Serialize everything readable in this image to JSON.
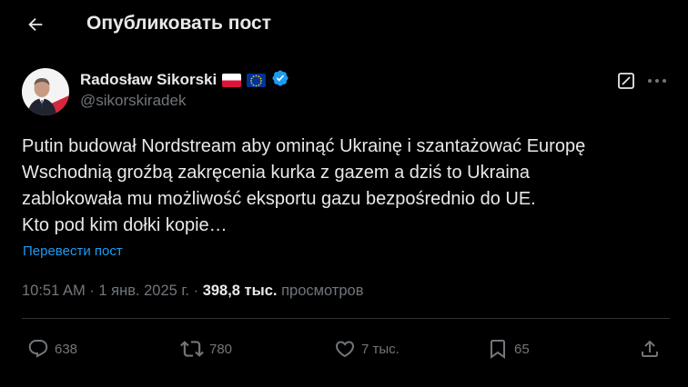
{
  "header": {
    "title": "Опубликовать пост"
  },
  "author": {
    "name": "Radosław Sikorski",
    "handle": "@sikorskiradek",
    "flags": [
      "poland-flag",
      "eu-flag"
    ],
    "verified": true
  },
  "post": {
    "lines": [
      "Putin budował Nordstream aby ominąć Ukrainę i szantażować Europę",
      "Wschodnią groźbą zakręcenia kurka z gazem a dziś to Ukraina",
      "zablokowała mu możliwość eksportu gazu bezpośrednio do UE.",
      "Kto pod kim dołki kopie…"
    ],
    "translate_label": "Перевести пост"
  },
  "meta": {
    "time": "10:51 AM",
    "separator": " · ",
    "date": "1 янв. 2025 г.",
    "views_count": "398,8 тыс.",
    "views_label": " просмотров"
  },
  "actions": {
    "replies": "638",
    "reposts": "780",
    "likes": "7 тыс.",
    "bookmarks": "65"
  },
  "colors": {
    "background": "#000000",
    "text": "#e7e9ea",
    "secondary": "#71767b",
    "link": "#1d9bf0",
    "divider": "#2f3336",
    "verified": "#1d9bf0"
  }
}
